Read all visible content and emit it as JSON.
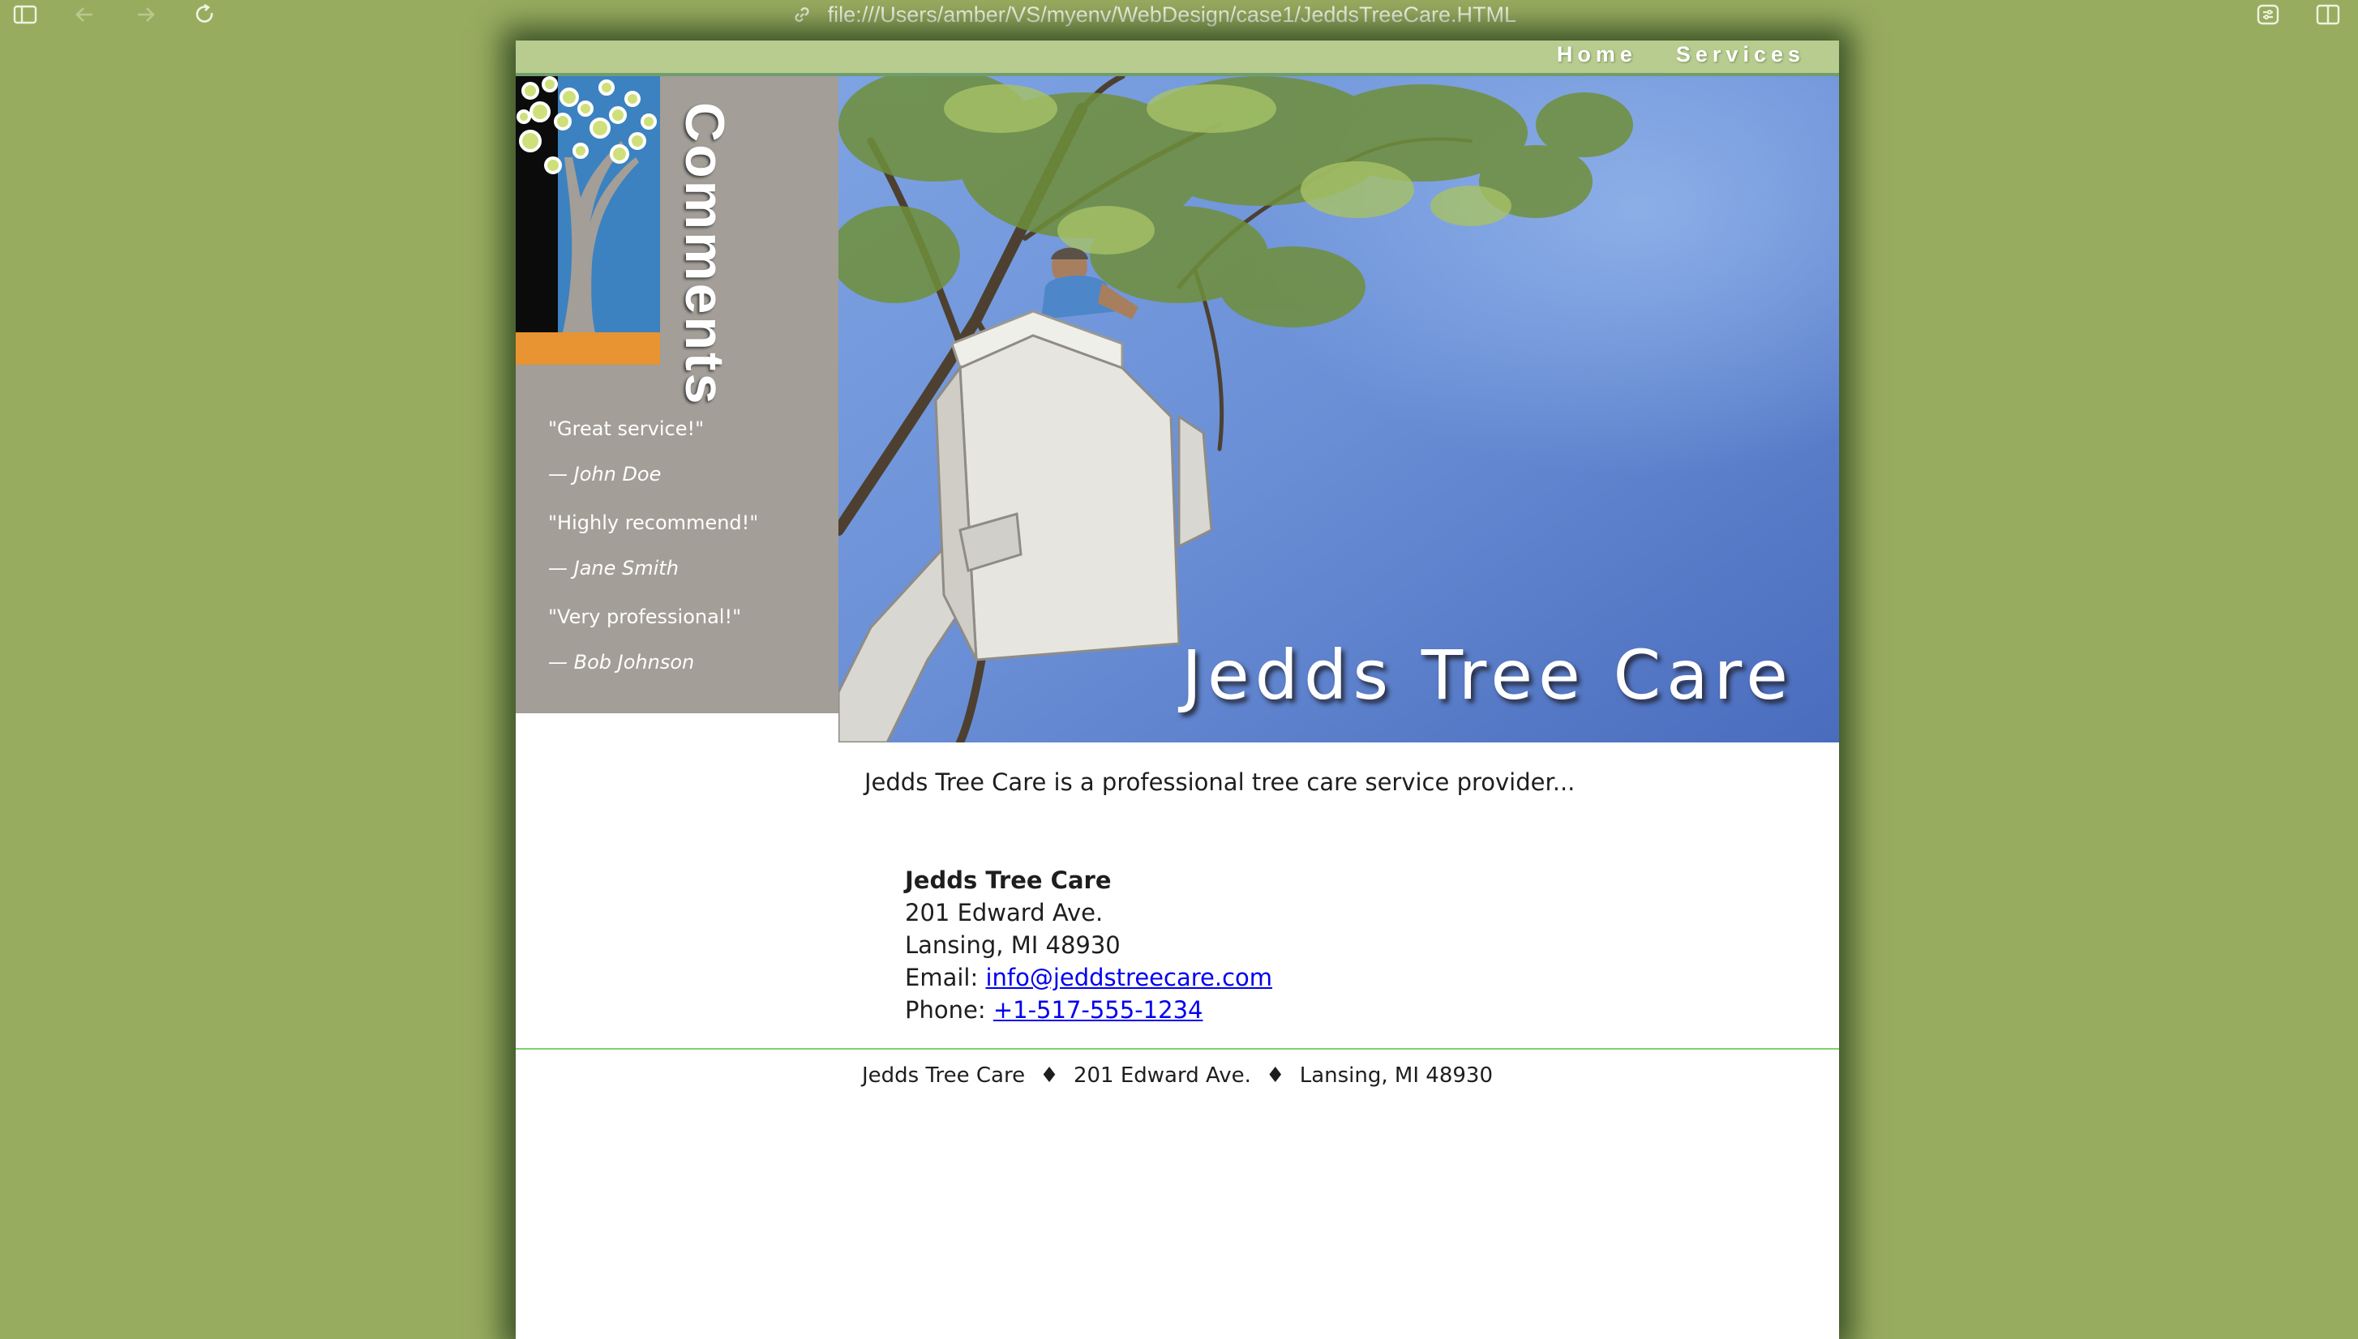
{
  "browser": {
    "url": "file:///Users/amber/VS/myenv/WebDesign/case1/JeddsTreeCare.HTML"
  },
  "nav": {
    "items": [
      {
        "label": "Home"
      },
      {
        "label": "Services"
      }
    ]
  },
  "sidebar": {
    "heading": "Comments",
    "comments": [
      {
        "quote": "\"Great service!\"",
        "author": "— John Doe"
      },
      {
        "quote": "\"Highly recommend!\"",
        "author": "— Jane Smith"
      },
      {
        "quote": "\"Very professional!\"",
        "author": "— Bob Johnson"
      }
    ]
  },
  "hero": {
    "title": "Jedds Tree Care"
  },
  "main": {
    "intro": "Jedds Tree Care is a professional tree care service provider...",
    "contact": {
      "name": "Jedds Tree Care",
      "street": "201 Edward Ave.",
      "city": "Lansing, MI 48930",
      "email_label": "Email:",
      "email": "info@jeddstreecare.com",
      "phone_label": "Phone:",
      "phone": "+1-517-555-1234"
    }
  },
  "footer": {
    "name": "Jedds Tree Care",
    "street": "201 Edward Ave.",
    "city": "Lansing, MI 48930",
    "separator": "♦"
  },
  "colors": {
    "background": "#98ac60",
    "nav_bar": "#b7cc8e",
    "sidebar": "#a39e97",
    "sky": "#5b7fc9",
    "footer_rule": "#7ed16a",
    "link": "#0000ee"
  },
  "icons": {
    "sidebar_toggle": "sidebar-icon",
    "back": "back-arrow-icon",
    "forward": "forward-arrow-icon",
    "reload": "reload-icon",
    "url_link": "link-icon",
    "extensions": "extensions-icon",
    "split_view": "split-view-icon"
  }
}
